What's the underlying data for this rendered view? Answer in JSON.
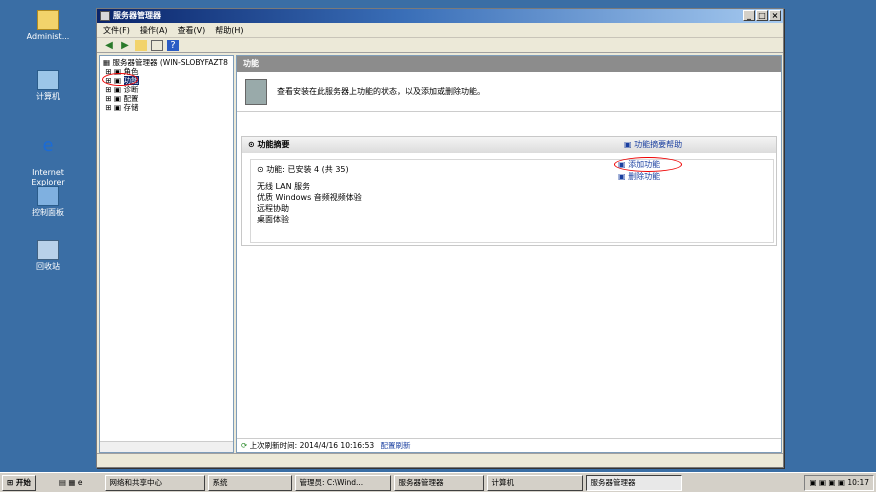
{
  "desktop": {
    "icons": [
      {
        "label": "Administ..."
      },
      {
        "label": "计算机"
      },
      {
        "label": "Internet\nExplorer"
      },
      {
        "label": "控制面板"
      },
      {
        "label": "回收站"
      }
    ]
  },
  "window": {
    "title": "服务器管理器",
    "buttons": {
      "min": "_",
      "max": "□",
      "close": "×"
    },
    "menu": [
      "文件(F)",
      "操作(A)",
      "查看(V)",
      "帮助(H)"
    ],
    "tree": {
      "root": "服务器管理器 (WIN-SLOBYFAZT8",
      "items": [
        "角色",
        "功能",
        "诊断",
        "配置",
        "存储"
      ]
    },
    "panel": {
      "header": "功能",
      "banner": "查看安装在此服务器上功能的状态，以及添加或删除功能。",
      "summary_title": "功能摘要",
      "summary_help": "功能摘要帮助",
      "features_line": "功能: 已安装 4 (共 35)",
      "features": [
        "无线 LAN 服务",
        "优质 Windows 音频视频体验",
        "远程协助",
        "桌面体验"
      ],
      "actions": [
        "添加功能",
        "删除功能"
      ],
      "refresh_text": "上次刷新时间: 2014/4/16 10:16:53",
      "refresh_link": "配置刷新"
    }
  },
  "taskbar": {
    "start": "开始",
    "tasks": [
      "网络和共享中心",
      "系统",
      "管理员: C:\\Wind...",
      "服务器管理器",
      "计算机",
      "服务器管理器"
    ],
    "clock": "10:17"
  }
}
